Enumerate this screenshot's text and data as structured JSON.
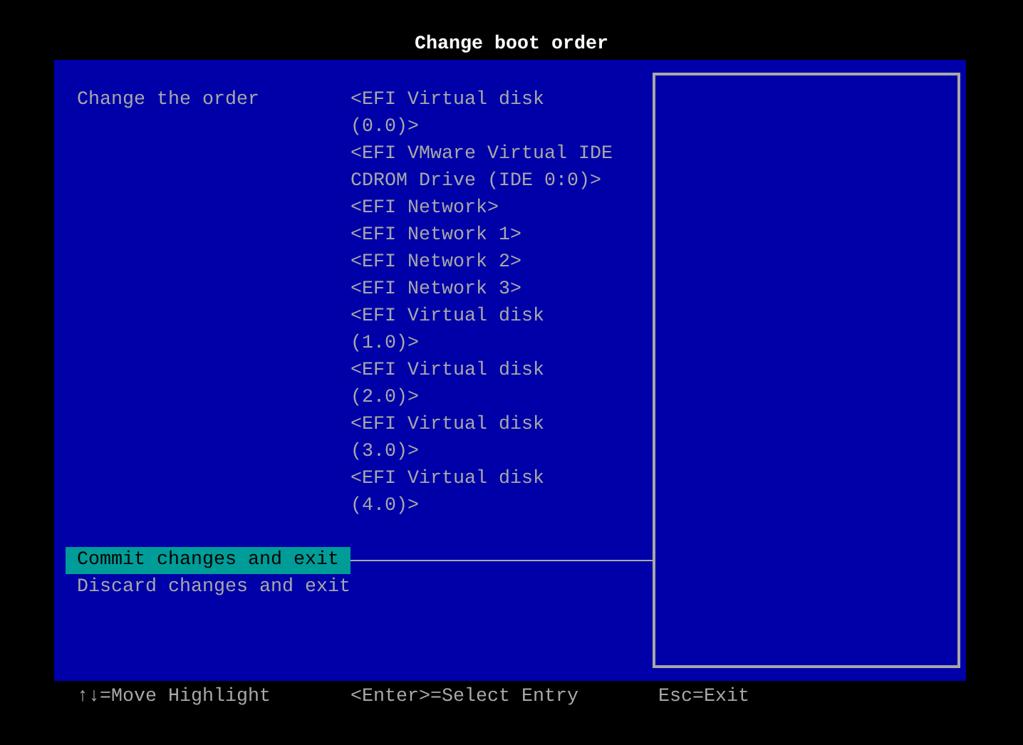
{
  "title": "Change boot order",
  "setting": {
    "label": "Change the order",
    "options": [
      "<EFI Virtual disk (0.0)>",
      "<EFI VMware Virtual IDE CDROM Drive (IDE 0:0)>",
      "<EFI Network>",
      "<EFI Network 1>",
      "<EFI Network 2>",
      "<EFI Network 3>",
      "<EFI Virtual disk (1.0)>",
      "<EFI Virtual disk (2.0)>",
      "<EFI Virtual disk (3.0)>",
      "<EFI Virtual disk (4.0)>"
    ]
  },
  "actions": [
    {
      "label": "Commit changes and exit",
      "selected": true
    },
    {
      "label": "Discard changes and exit",
      "selected": false
    }
  ],
  "footer": [
    "↑↓=Move Highlight",
    "<Enter>=Select Entry",
    "Esc=Exit"
  ]
}
